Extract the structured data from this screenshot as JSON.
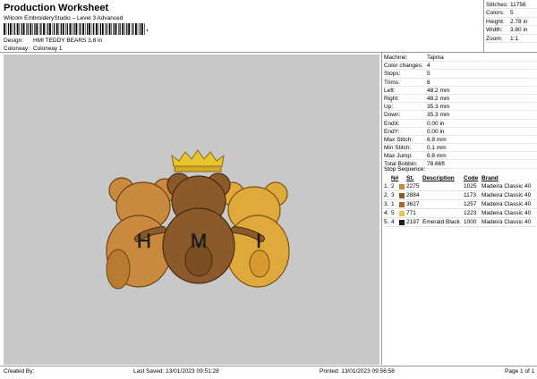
{
  "header": {
    "title": "Production Worksheet",
    "subtitle": "Wilcom EmbroideryStudio – Level 3 Advanced",
    "barcode_mark": ",",
    "design_label": "Design:",
    "design_value": "HMI TEDDY BEARS 3,8 in",
    "colorway_label": "Colorway:",
    "colorway_value": "Colorway 1"
  },
  "stats": [
    {
      "k": "Stitches:",
      "v": "11756"
    },
    {
      "k": "Colors:",
      "v": "5"
    },
    {
      "k": "Height:",
      "v": "2.78 in"
    },
    {
      "k": "Width:",
      "v": "3.80 in"
    },
    {
      "k": "Zoom:",
      "v": "1:1"
    }
  ],
  "design_letters": [
    "H",
    "M",
    "I"
  ],
  "machine": [
    {
      "k": "Machine:",
      "v": "Tajima"
    },
    {
      "k": "Color changes:",
      "v": "4"
    },
    {
      "k": "Stops:",
      "v": "5"
    },
    {
      "k": "Trims:",
      "v": "8"
    },
    {
      "k": "Left:",
      "v": "48.2 mm"
    },
    {
      "k": "Right:",
      "v": "48.2 mm"
    },
    {
      "k": "Up:",
      "v": "35.3 mm"
    },
    {
      "k": "Down:",
      "v": "35.3 mm"
    },
    {
      "k": "EndX:",
      "v": "0.00 in"
    },
    {
      "k": "EndY:",
      "v": "0.00 in"
    },
    {
      "k": "Max Stitch:",
      "v": "6.8 mm"
    },
    {
      "k": "Min Stitch:",
      "v": "0.1 mm"
    },
    {
      "k": "Max Jump:",
      "v": "6.8 mm"
    },
    {
      "k": "Total Bobbin:",
      "v": "78.66ft"
    }
  ],
  "sequence": {
    "title": "Stop Sequence:",
    "headers": {
      "n": "N#",
      "st": "St.",
      "desc": "Description",
      "code": "Code",
      "brand": "Brand"
    },
    "rows": [
      {
        "stop": "1.",
        "n": "2",
        "swatch": "#c98a3f",
        "st": "2275",
        "desc": "",
        "code": "1025",
        "brand": "Madeira Classic 40"
      },
      {
        "stop": "2.",
        "n": "3",
        "swatch": "#8b5a2b",
        "st": "2884",
        "desc": "",
        "code": "1173",
        "brand": "Madeira Classic 40"
      },
      {
        "stop": "3.",
        "n": "1",
        "swatch": "#a8652e",
        "st": "3627",
        "desc": "",
        "code": "1257",
        "brand": "Madeira Classic 40"
      },
      {
        "stop": "4.",
        "n": "5",
        "swatch": "#e8c44a",
        "st": "771",
        "desc": "",
        "code": "1223",
        "brand": "Madeira Classic 40"
      },
      {
        "stop": "5.",
        "n": "4",
        "swatch": "#1a1a1a",
        "st": "2197",
        "desc": "Emerald Black",
        "code": "1000",
        "brand": "Madeira Classic 40"
      }
    ]
  },
  "footer": {
    "created_by": "Created By:",
    "last_saved": "Last Saved: 13/01/2023 09:51:28",
    "printed": "Printed: 13/01/2023 09:56:58",
    "page": "Page 1 of 1"
  }
}
